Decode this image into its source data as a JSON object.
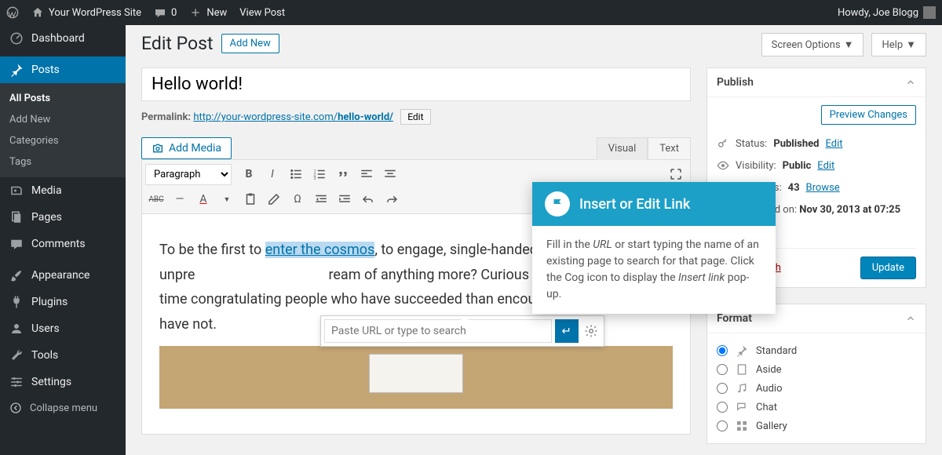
{
  "adminbar": {
    "site_name": "Your WordPress Site",
    "comments": "0",
    "new": "New",
    "view_post": "View Post",
    "howdy": "Howdy, Joe Blogg"
  },
  "sidebar": {
    "items": [
      {
        "label": "Dashboard"
      },
      {
        "label": "Posts"
      },
      {
        "label": "Media"
      },
      {
        "label": "Pages"
      },
      {
        "label": "Comments"
      },
      {
        "label": "Appearance"
      },
      {
        "label": "Plugins"
      },
      {
        "label": "Users"
      },
      {
        "label": "Tools"
      },
      {
        "label": "Settings"
      }
    ],
    "posts_submenu": [
      {
        "label": "All Posts"
      },
      {
        "label": "Add New"
      },
      {
        "label": "Categories"
      },
      {
        "label": "Tags"
      }
    ],
    "collapse": "Collapse menu"
  },
  "screen": {
    "options": "Screen Options",
    "help": "Help"
  },
  "page": {
    "title": "Edit Post",
    "add_new": "Add New"
  },
  "post": {
    "title": "Hello world!",
    "permalink_label": "Permalink:",
    "permalink_base": "http://your-wordpress-site.com/",
    "permalink_slug": "hello-world/",
    "edit": "Edit",
    "add_media": "Add Media",
    "tabs": {
      "visual": "Visual",
      "text": "Text"
    },
    "format_sel": "Paragraph",
    "body_before": "To be the first to ",
    "body_highlight": "enter the cosmos",
    "body_after": ", to engage, single-handed, in an unpre",
    "body_after2": "ream of anything more? Curious that we spend more time congratulating people who have succeeded than encouraging people who have not."
  },
  "linkpop": {
    "placeholder": "Paste URL or type to search"
  },
  "tooltip": {
    "title": "Insert or Edit Link",
    "body_1": "Fill in the ",
    "body_em1": "URL",
    "body_2": " or start typing the name of an existing page to search for that page. Click the Cog icon to display the ",
    "body_em2": "Insert link",
    "body_3": " pop-up."
  },
  "publish": {
    "title": "Publish",
    "preview": "Preview Changes",
    "status_label": "Status:",
    "status_value": "Published",
    "visibility_label": "Visibility:",
    "visibility_value": "Public",
    "revisions_label": "Revisions:",
    "revisions_value": "43",
    "browse": "Browse",
    "published_label": "Published on:",
    "published_value": "Nov 30, 2013 at 07:25",
    "edit": "Edit",
    "trash": "Move to Trash",
    "update": "Update"
  },
  "format": {
    "title": "Format",
    "options": [
      "Standard",
      "Aside",
      "Audio",
      "Chat",
      "Gallery"
    ]
  }
}
